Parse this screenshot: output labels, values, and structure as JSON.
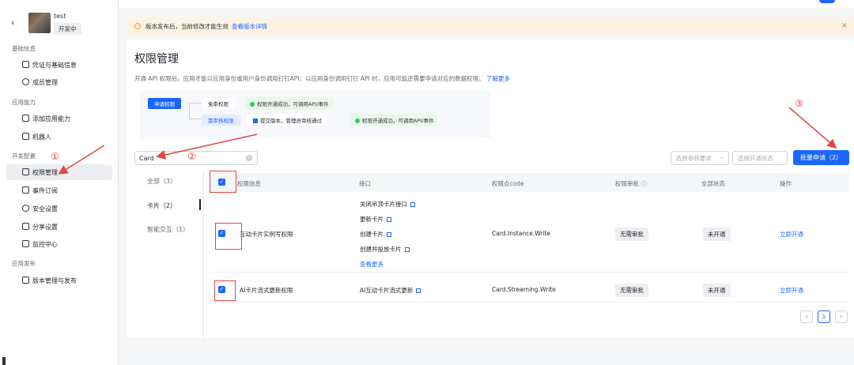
{
  "sidebar": {
    "app_name": "test",
    "env_badge": "开发中",
    "sections": {
      "basic": "基础信息",
      "ability": "应用能力",
      "dev": "开发配置",
      "release": "应用发布"
    },
    "items": {
      "credentials": "凭证与基础信息",
      "members": "成员管理",
      "add_ability": "添加应用能力",
      "robot": "机器人",
      "permission": "权限管理",
      "events": "事件订阅",
      "security": "安全设置",
      "share": "分享设置",
      "monitor": "监控中心",
      "version": "版本管理与发布"
    }
  },
  "notice": {
    "text": "版本发布后，当前修改才能生效",
    "link": "查看版本详情"
  },
  "main": {
    "title": "权限管理",
    "description": "开通 API 权限后，应用才能以应用身份或用户身份调用钉钉API；以应用身份调用钉钉 API 时，应用可能还需要申请对应的数据权限。",
    "learn_more": "了解更多",
    "flow": {
      "apply": "申请权限",
      "no_review": "免审权限",
      "need_review": "需审核权限",
      "submit": "提交版本，管理员审核通过",
      "success1": "权限开通成功，可调用API/事件",
      "success2": "权限开通成功，可调用API/事件"
    },
    "search_value": "Card",
    "filter_review": "选择审核要求",
    "filter_status": "选择开通状态",
    "batch_button": "批量申请（2）",
    "categories": [
      "全部（3）",
      "卡片（2）",
      "智能交互（1）"
    ],
    "table": {
      "headers": [
        "权限信息",
        "接口",
        "权限点code",
        "权限审批 ⓘ",
        "全部状态",
        "操作"
      ],
      "rows": [
        {
          "name": "互动卡片实例写权限",
          "apis": [
            "关闭吊顶卡片接口",
            "更新卡片",
            "创建卡片",
            "创建并投放卡片"
          ],
          "more": "查看更多",
          "code": "Card.Instance.Write",
          "review": "无需审批",
          "status": "未开通",
          "action": "立即开通"
        },
        {
          "name": "AI卡片流式更新权限",
          "apis": [
            "AI互动卡片流式更新"
          ],
          "code": "Card.Streaming.Write",
          "review": "无需审批",
          "status": "未开通",
          "action": "立即开通"
        }
      ]
    },
    "pager": {
      "prev": "<",
      "page": "1",
      "next": ">"
    }
  },
  "annotations": {
    "a1": "①",
    "a2": "②",
    "a3": "③"
  },
  "colors": {
    "accent": "#1a66ff",
    "annotation": "#e54545",
    "notice_bg": "#fdf3e4"
  }
}
